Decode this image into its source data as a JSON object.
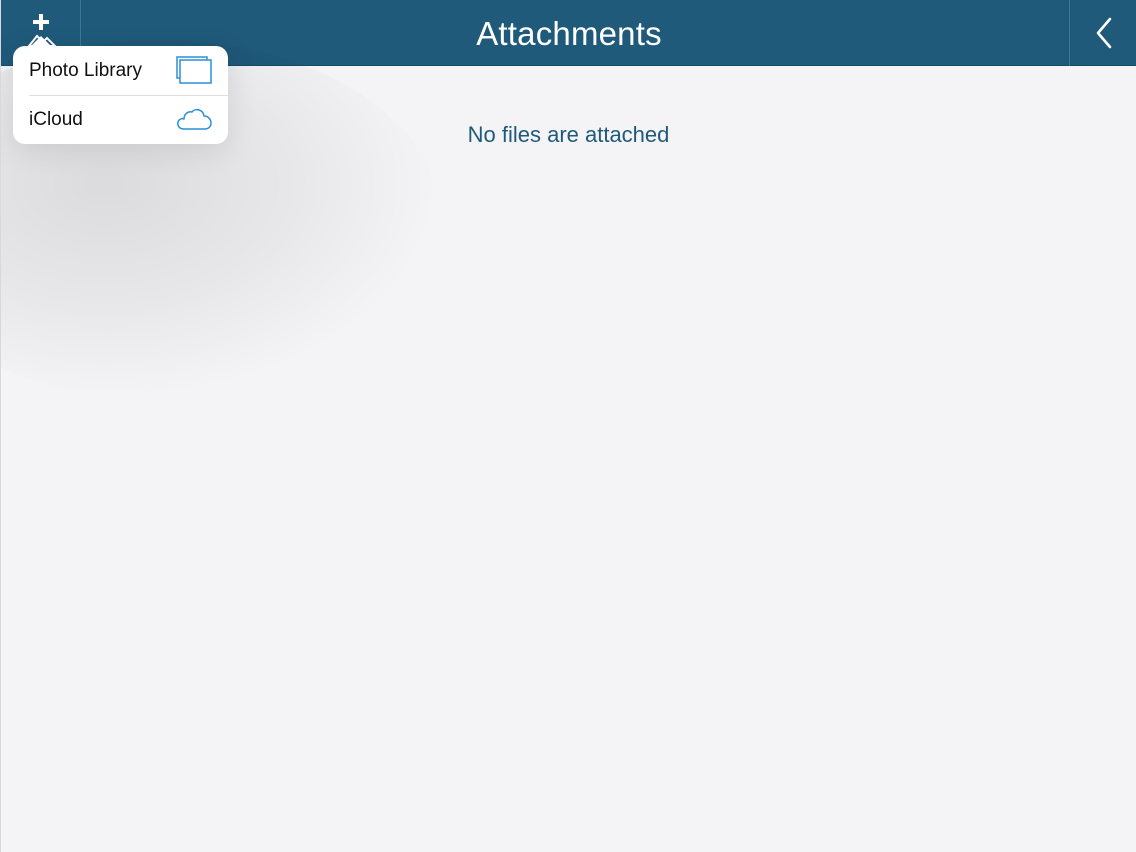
{
  "navbar": {
    "title": "Attachments",
    "left_icon": "add-photo-icon",
    "right_icon": "chevron-left-icon",
    "background_color": "#1f5a7a"
  },
  "main": {
    "empty_message": "No files are attached",
    "message_color": "#1f5a7a"
  },
  "popover": {
    "items": [
      {
        "label": "Photo Library",
        "icon": "photo-library-icon"
      },
      {
        "label": "iCloud",
        "icon": "cloud-icon"
      }
    ],
    "icon_color": "#2b8fd6"
  }
}
